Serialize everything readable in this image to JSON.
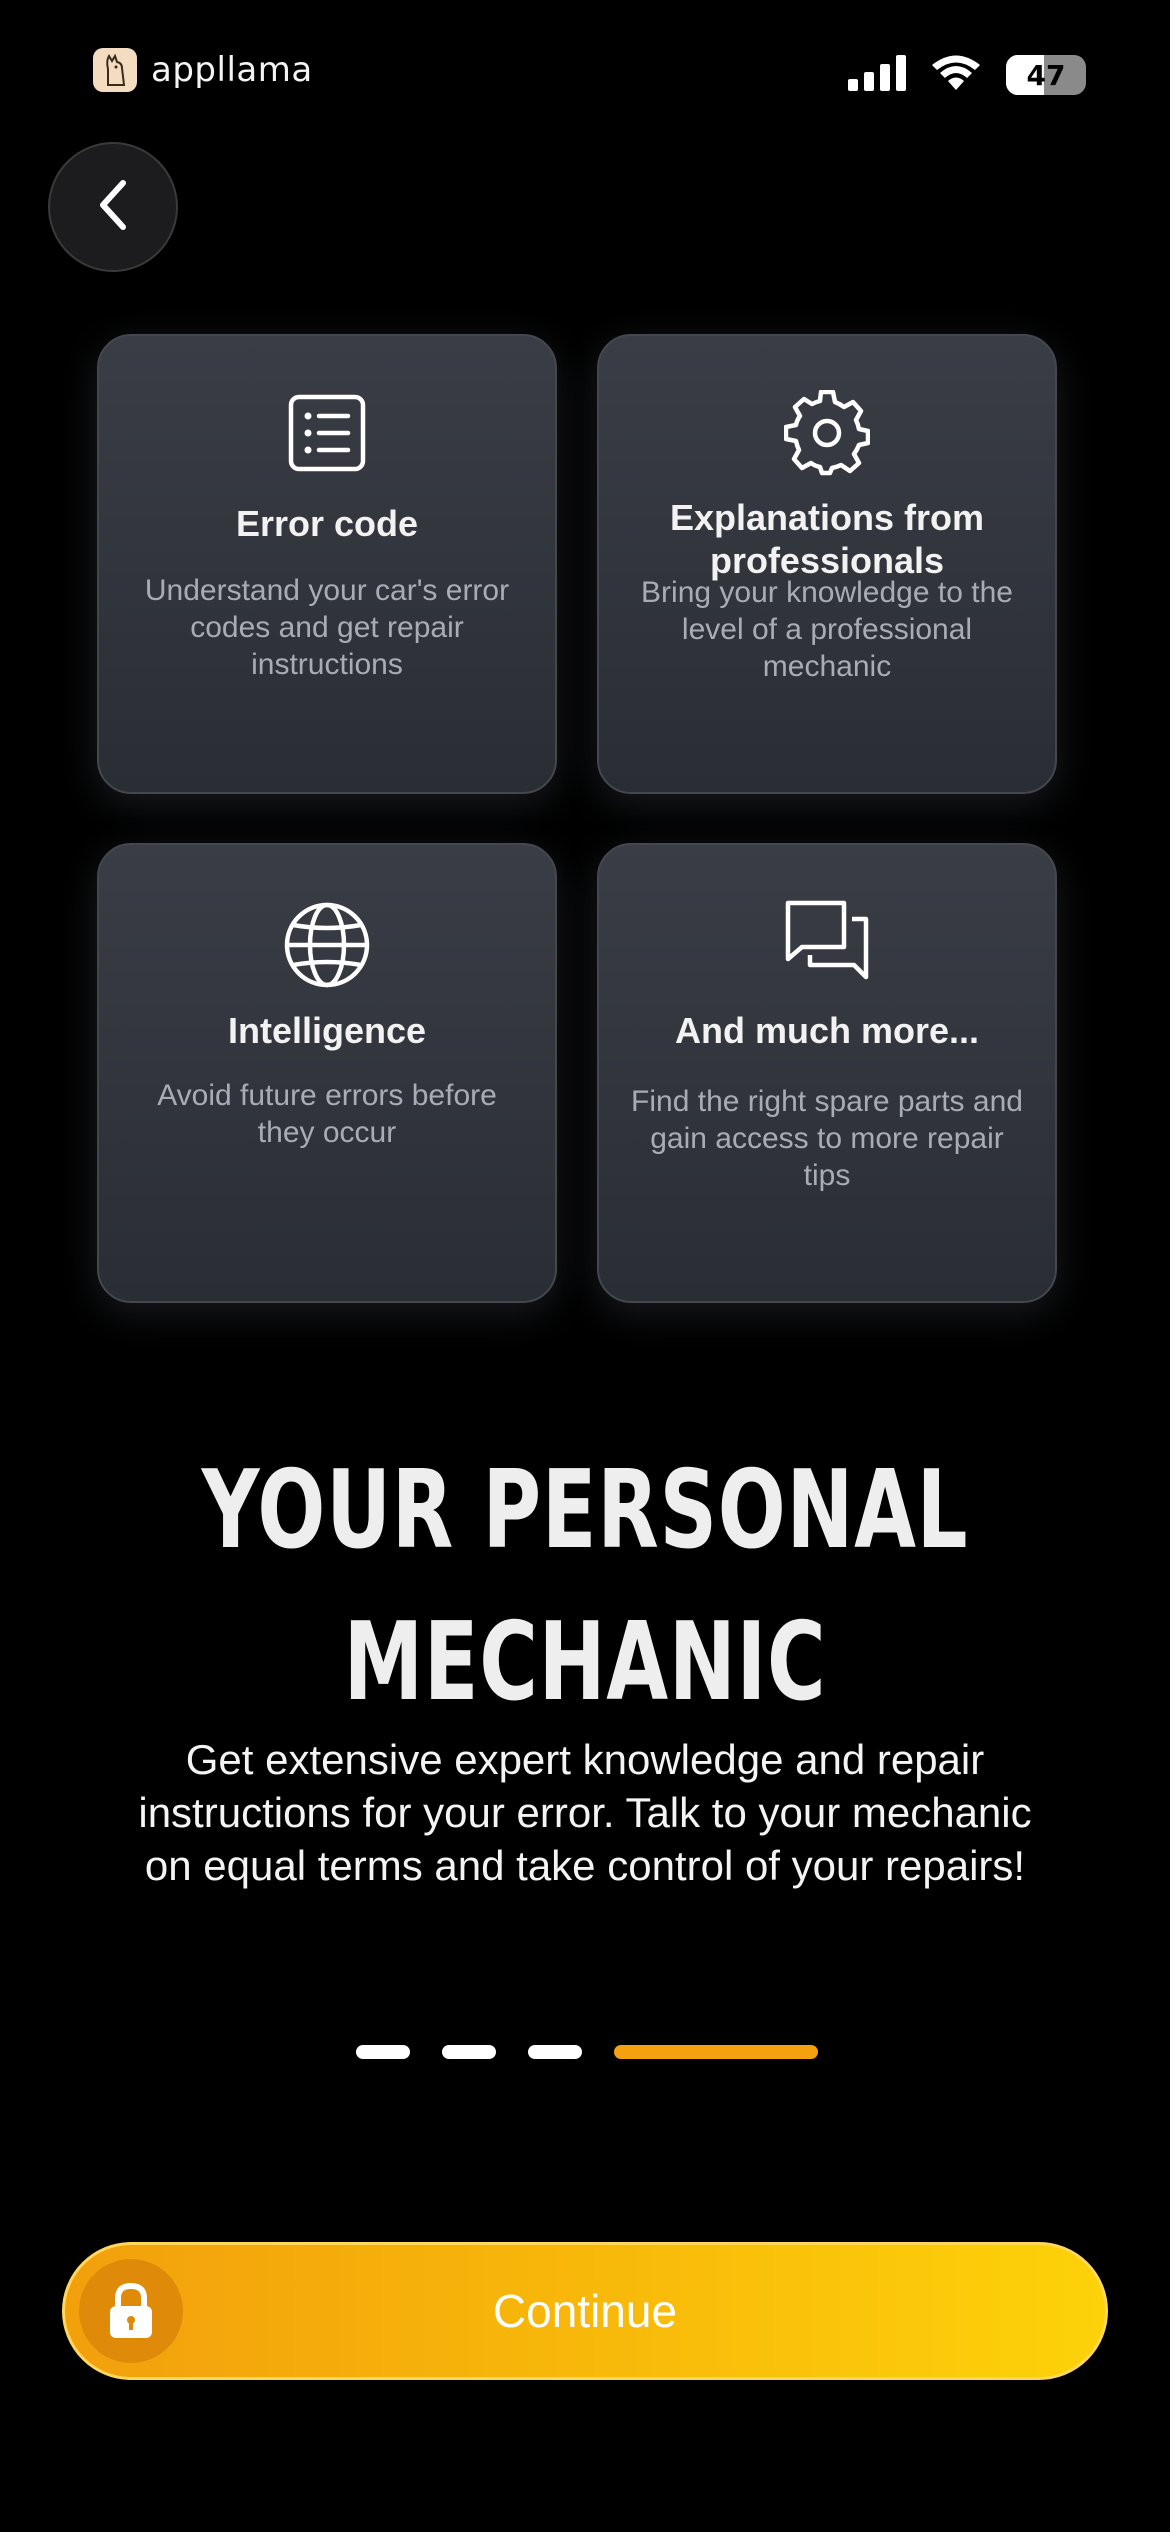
{
  "status_bar": {
    "brand_name": "appllama",
    "battery_level": 47,
    "battery_text": "47",
    "icons": [
      "signal-icon",
      "wifi-icon",
      "battery-icon"
    ]
  },
  "back_button": {
    "icon": "chevron-left-icon"
  },
  "features": [
    {
      "icon": "list-icon",
      "title": "Error code",
      "description": "Understand your car's error codes and get repair instructions"
    },
    {
      "icon": "gear-icon",
      "title": "Explanations from professionals",
      "description": "Bring your knowledge to the level of a professional mechanic"
    },
    {
      "icon": "globe-icon",
      "title": "Intelligence",
      "description": "Avoid future errors before they occur"
    },
    {
      "icon": "chat-icon",
      "title": "And much more...",
      "description": "Find the right spare parts and gain access to more repair tips"
    }
  ],
  "headline": {
    "line1": "YOUR PERSONAL",
    "line2": "MECHANIC"
  },
  "subtitle": "Get extensive expert knowledge and repair instructions for your error. Talk to your mechanic on equal terms and take control of your repairs!",
  "pagination": {
    "total": 4,
    "current": 4
  },
  "continue_button": {
    "label": "Continue",
    "icon": "lock-icon"
  },
  "colors": {
    "background": "#000000",
    "card": "#32353c",
    "accent_orange": "#f5a00f",
    "accent_yellow": "#fdd209"
  }
}
